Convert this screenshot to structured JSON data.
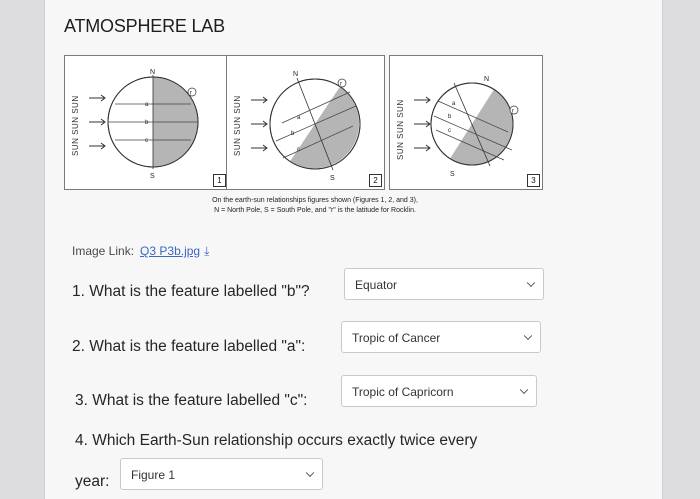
{
  "page": {
    "title": "ATMOSPHERE LAB"
  },
  "figure": {
    "caption_line1": "On the earth-sun relationships figures shown (Figures 1, 2, and 3),",
    "caption_line2": "N = North Pole, S = South Pole, and \"r\" is the latitude for Rocklin.",
    "sun_label": "SUN SUN SUN",
    "panels": [
      {
        "number": "1",
        "north": "N",
        "south": "S",
        "lines": [
          "a",
          "b",
          "c"
        ],
        "r": "r"
      },
      {
        "number": "2",
        "north": "N",
        "south": "S",
        "lines": [
          "a",
          "b",
          "c"
        ],
        "r": "r"
      },
      {
        "number": "3",
        "north": "N",
        "south": "S",
        "lines": [
          "a",
          "b",
          "c"
        ],
        "r": "r"
      }
    ]
  },
  "image_link": {
    "label": "Image Link:",
    "link_text": "Q3 P3b.jpg",
    "download_icon": "download-icon"
  },
  "questions": [
    {
      "text": "1. What is the feature labelled \"b\"?",
      "answer": "Equator"
    },
    {
      "text": "2. What is the feature labelled \"a\":",
      "answer": "Tropic of Cancer"
    },
    {
      "text": "3. What is the feature labelled \"c\":",
      "answer": "Tropic of Capricorn"
    },
    {
      "text_line1": "4. Which Earth-Sun relationship occurs exactly twice every",
      "text_line2": "year:",
      "answer": "Figure 1"
    }
  ]
}
